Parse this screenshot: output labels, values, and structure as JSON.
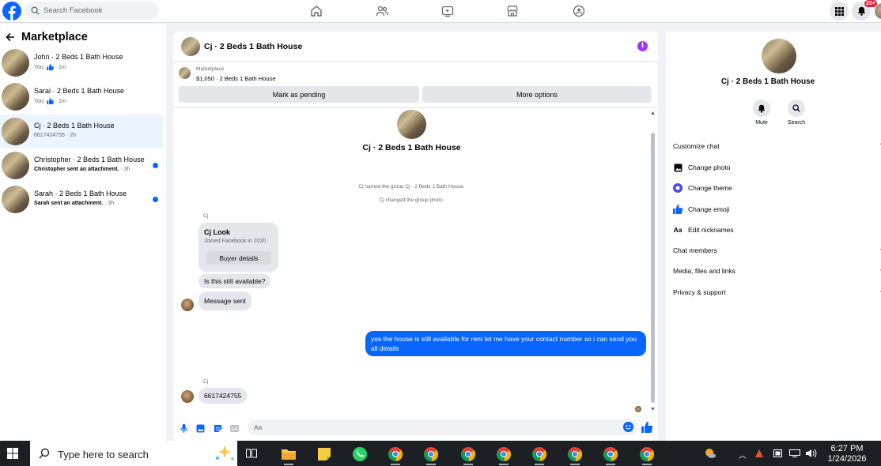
{
  "topbar": {
    "search_placeholder": "Search Facebook",
    "notification_count": "20+"
  },
  "sidebar": {
    "title": "Marketplace",
    "conversations": [
      {
        "title": "John · 2 Beds 1 Bath House",
        "prefix": "You:",
        "suffix": "· 1m",
        "unread": false
      },
      {
        "title": "Sarai · 2 Beds 1 Bath House",
        "prefix": "You:",
        "suffix": "· 1m",
        "unread": false
      },
      {
        "title": "Cj · 2 Beds 1 Bath House",
        "prefix": "6617424755",
        "suffix": "· 2h",
        "unread": false
      },
      {
        "title": "Christopher · 2 Beds 1 Bath House",
        "prefix": "Christopher sent an attachment.",
        "suffix": "· 3h",
        "unread": true
      },
      {
        "title": "Sarah · 2 Beds 1 Bath House",
        "prefix": "Sarah sent an attachment.",
        "suffix": "· 3h",
        "unread": true
      }
    ]
  },
  "chat": {
    "header_name": "Cj · 2 Beds 1 Bath House",
    "listing_label": "Marketplace",
    "listing_price": "$1,050 · 2 Beds 1 Bath House",
    "mark_pending": "Mark as pending",
    "more_options": "More options",
    "big_name": "Cj · 2 Beds 1 Bath House",
    "system_messages": [
      "Cj named the group Cj · 2 Beds 1 Bath House.",
      "Cj changed the group photo."
    ],
    "sender_name": "Cj",
    "card_title": "Cj Look",
    "card_sub": "Joined Facebook in 2020",
    "card_button": "Buyer details",
    "msg_1": "Is this still available?",
    "msg_2": "Message sent",
    "msg_out": "yes the house is still available for rent let me have your contact number so i can send you all details",
    "sender_name_2": "Cj",
    "msg_3": "6617424755",
    "input_placeholder": "Aa"
  },
  "right_panel": {
    "name": "Cj · 2 Beds 1 Bath House",
    "mute_label": "Mute",
    "search_label": "Search",
    "customize_chat": "Customize chat",
    "change_photo": "Change photo",
    "change_theme": "Change theme",
    "change_emoji": "Change emoji",
    "edit_nicknames": "Edit nicknames",
    "nick_icon_text": "Aa",
    "chat_members": "Chat members",
    "media_files": "Media, files and links",
    "privacy_support": "Privacy & support"
  },
  "taskbar": {
    "search_placeholder": "Type here to search",
    "time": "6:27 PM",
    "date": "1/24/2026"
  },
  "colors": {
    "brand_blue": "#0866ff",
    "info_purple": "#a033ff",
    "badge_red": "#e41e3f"
  }
}
